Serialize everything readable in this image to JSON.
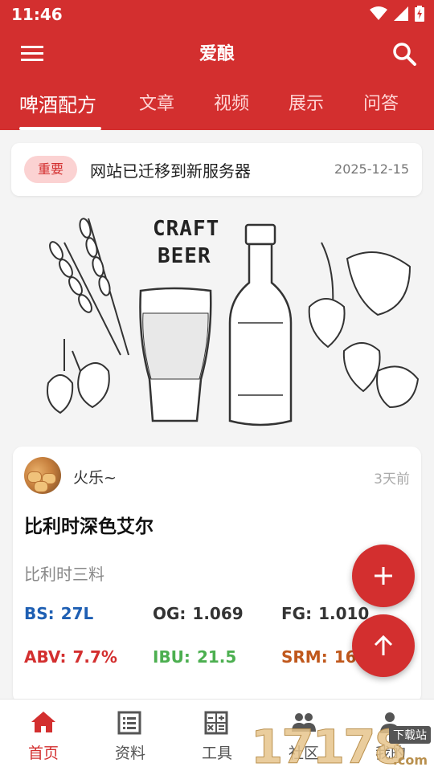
{
  "status_bar": {
    "time": "11:46"
  },
  "app_bar": {
    "title": "爱酿"
  },
  "tabs": [
    {
      "label": "啤酒配方",
      "active": true
    },
    {
      "label": "文章"
    },
    {
      "label": "视频"
    },
    {
      "label": "展示"
    },
    {
      "label": "问答"
    }
  ],
  "notice": {
    "badge": "重要",
    "text": "网站已迁移到新服务器",
    "date": "2025-12-15"
  },
  "banner": {
    "line1": "CRAFT",
    "line2": "BEER"
  },
  "recipe_card": {
    "author": "火乐~",
    "time_ago": "3天前",
    "title": "比利时深色艾尔",
    "description": "比利时三料",
    "stats": {
      "bs_label": "BS:",
      "bs_value": "27L",
      "og_label": "OG:",
      "og_value": "1.069",
      "fg_label": "FG:",
      "fg_value": "1.010",
      "abv_label": "ABV:",
      "abv_value": "7.7%",
      "ibu_label": "IBU:",
      "ibu_value": "21.5",
      "srm_label": "SRM:",
      "srm_value": "16.6"
    }
  },
  "bottom_nav": [
    {
      "label": "首页",
      "icon": "home-icon",
      "active": true
    },
    {
      "label": "资料",
      "icon": "list-icon"
    },
    {
      "label": "工具",
      "icon": "calculator-icon"
    },
    {
      "label": "社区",
      "icon": "community-icon"
    },
    {
      "label": "我的",
      "icon": "person-icon"
    }
  ],
  "watermark": {
    "digits": "17178",
    "tag": "下载站",
    "suffix": ".com"
  },
  "colors": {
    "primary": "#d32f2f",
    "badge_bg": "#fbd2d2",
    "bs": "#1e5fb3",
    "abv": "#d32f2f",
    "ibu": "#4caf50",
    "srm": "#c0581c"
  }
}
